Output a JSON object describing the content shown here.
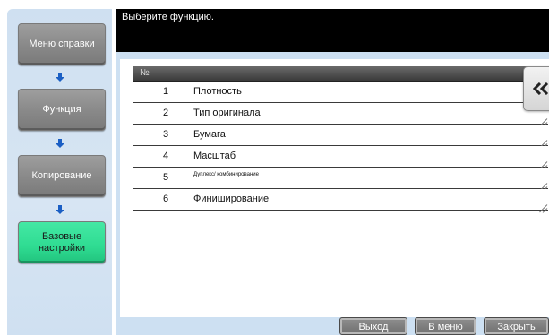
{
  "nav": {
    "items": [
      {
        "label": "Меню справки"
      },
      {
        "label": "Функция"
      },
      {
        "label": "Копирование"
      },
      {
        "label": "Базовые настройки"
      }
    ]
  },
  "message": "Выберите функцию.",
  "table": {
    "header_no": "№",
    "rows": [
      {
        "num": "1",
        "name": "Плотность"
      },
      {
        "num": "2",
        "name": "Тип оригинала"
      },
      {
        "num": "3",
        "name": "Бумага"
      },
      {
        "num": "4",
        "name": "Масштаб"
      },
      {
        "num": "5",
        "name": "Дуплекс/ комбинирование"
      },
      {
        "num": "6",
        "name": "Финиширование"
      }
    ]
  },
  "bottom": {
    "exit_label": "Выход",
    "menu_label": "В меню",
    "close_label": "Закрыть"
  },
  "icons": {
    "side_tab": "double-left-arrow-icon",
    "nav_arrow": "arrow-down-icon"
  },
  "colors": {
    "active": "#2fdc92",
    "nav_button": "#8a8a8a",
    "panel": "#cde0f2",
    "arrow": "#1b5fc4"
  }
}
